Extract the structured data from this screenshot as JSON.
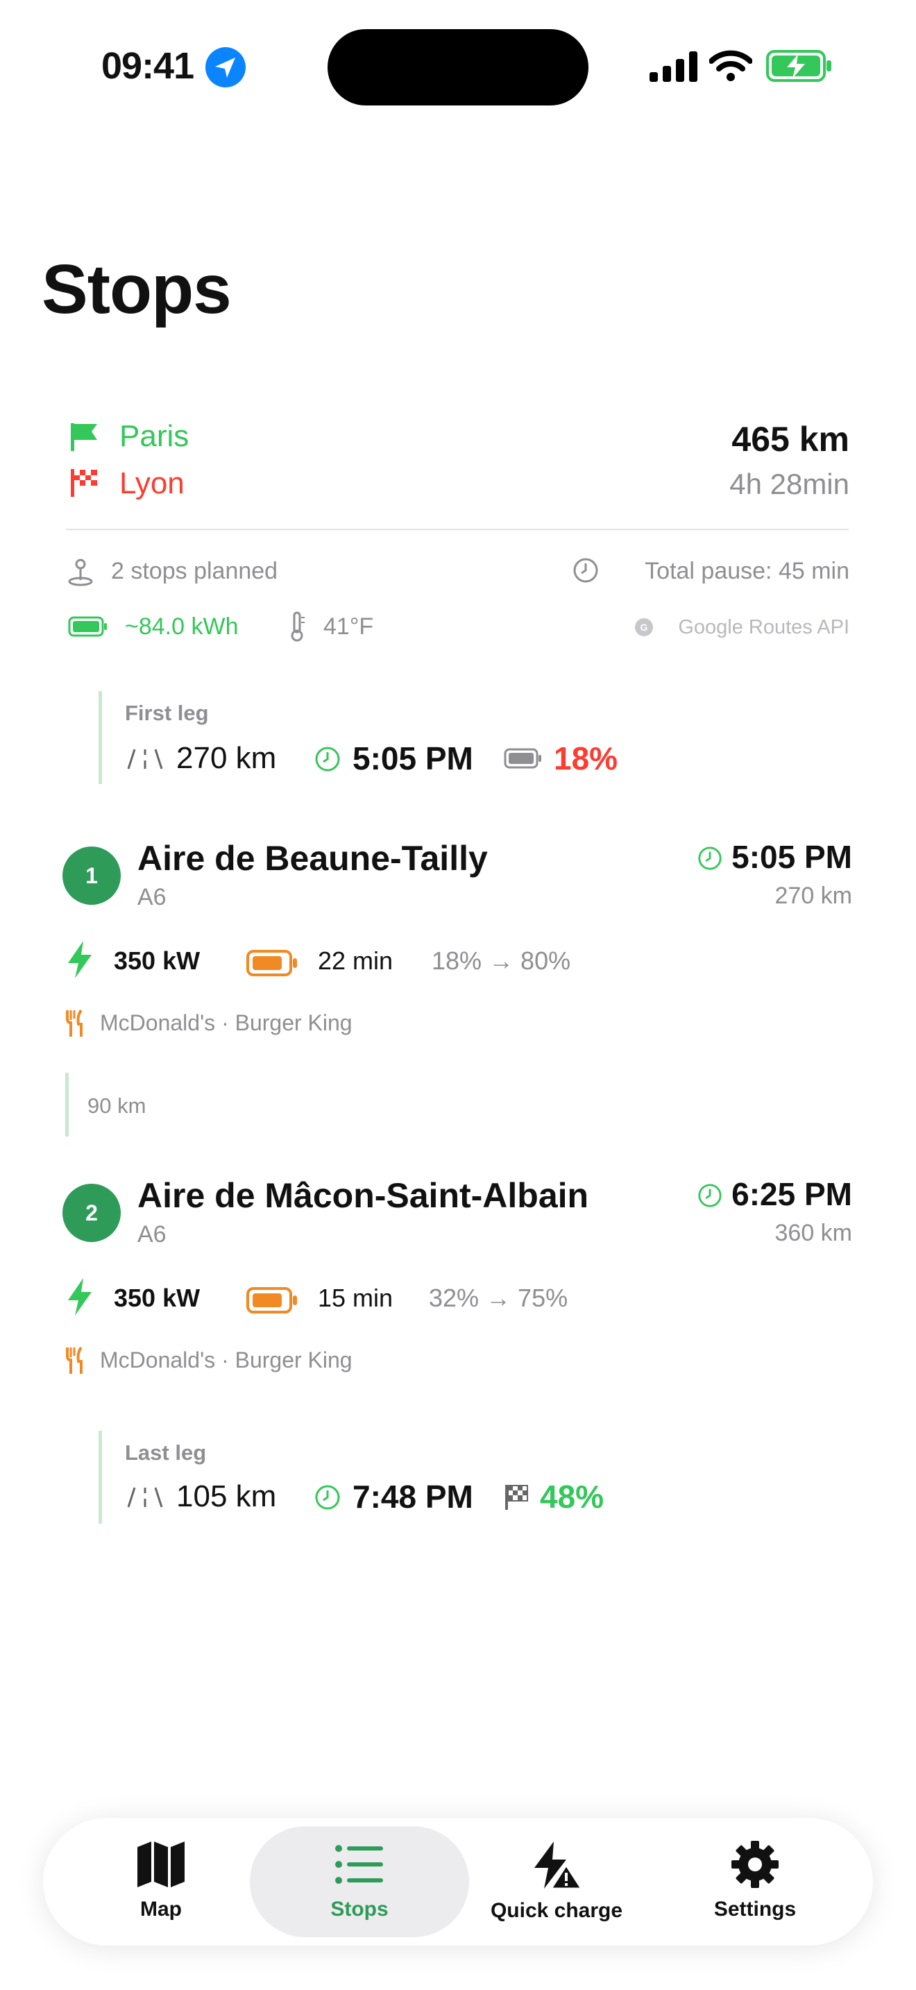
{
  "status_bar": {
    "time": "09:41"
  },
  "page_title": "Stops",
  "route": {
    "origin": "Paris",
    "destination": "Lyon",
    "distance": "465 km",
    "duration": "4h 28min",
    "stops_planned": "2 stops planned",
    "total_pause": "Total pause: 45 min",
    "energy": "~84.0 kWh",
    "temperature": "41°F",
    "source": "Google Routes API"
  },
  "first_leg": {
    "label": "First leg",
    "distance": "270 km",
    "time": "5:05 PM",
    "battery": "18%"
  },
  "stops": [
    {
      "number": "1",
      "name": "Aire de Beaune-Tailly",
      "road": "A6",
      "time": "5:05 PM",
      "distance": "270 km",
      "power": "350 kW",
      "duration": "22 min",
      "soc": "18% → 80%",
      "food": "McDonald's · Burger King"
    },
    {
      "number": "2",
      "name": "Aire de Mâcon-Saint-Albain",
      "road": "A6",
      "time": "6:25 PM",
      "distance": "360 km",
      "power": "350 kW",
      "duration": "15 min",
      "soc": "32% → 75%",
      "food": "McDonald's · Burger King"
    }
  ],
  "between_leg": {
    "distance": "90 km"
  },
  "last_leg": {
    "label": "Last leg",
    "distance": "105 km",
    "time": "7:48 PM",
    "battery": "48%"
  },
  "tabs": [
    {
      "label": "Map",
      "icon": "map-icon"
    },
    {
      "label": "Stops",
      "icon": "list-icon"
    },
    {
      "label": "Quick charge",
      "icon": "bolt-warning-icon"
    },
    {
      "label": "Settings",
      "icon": "gear-icon"
    }
  ],
  "colors": {
    "accent_green": "#34C759",
    "dark_green": "#2e9b58",
    "red": "#FF3B30",
    "orange": "#F08A24",
    "grey": "#8e8e93"
  }
}
